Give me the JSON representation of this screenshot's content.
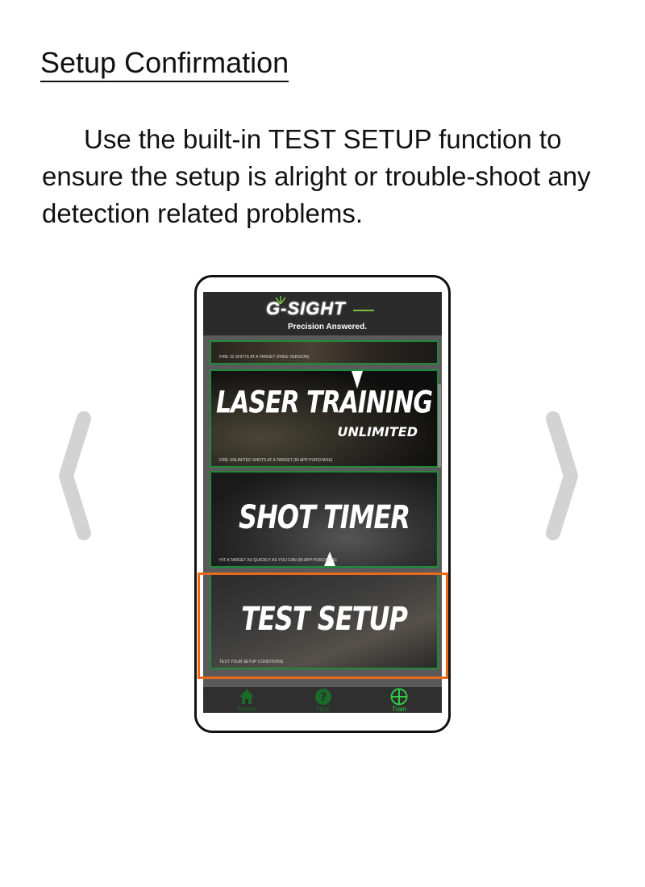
{
  "page": {
    "title": "Setup Confirmation",
    "intro": "Use the built-in TEST SETUP function to ensure the setup is alright or trouble-shoot any detection related problems."
  },
  "nav": {
    "prev_icon": "chevron-left-icon",
    "next_icon": "chevron-right-icon"
  },
  "app": {
    "logo": "G-SIGHT",
    "tagline": "Precision Answered.",
    "cards": [
      {
        "title": "",
        "subtitle": "",
        "caption": "FIRE 10 SHOTS AT A TARGET (FREE VERSION)"
      },
      {
        "title": "LASER TRAINING",
        "subtitle": "UNLIMITED",
        "caption": "FIRE UNLIMITED SHOTS AT A TARGET (IN APP PURCHASE)"
      },
      {
        "title": "SHOT TIMER",
        "subtitle": "",
        "caption": "HIT A TARGET AS QUICKLY AS YOU CAN (IN APP PURCHASE)"
      },
      {
        "title": "TEST SETUP",
        "subtitle": "",
        "caption": "TEST YOUR SETUP CONDITIONS"
      }
    ],
    "tabs": [
      {
        "label": "Home",
        "icon": "home-icon",
        "active": false
      },
      {
        "label": "Help",
        "icon": "help-icon",
        "active": false
      },
      {
        "label": "Train",
        "icon": "crosshair-icon",
        "active": true
      }
    ]
  },
  "colors": {
    "highlight": "#ea6a1c",
    "brand_green": "#7ac143",
    "card_border": "#1f8a3a",
    "active_tab": "#2ecc40"
  }
}
